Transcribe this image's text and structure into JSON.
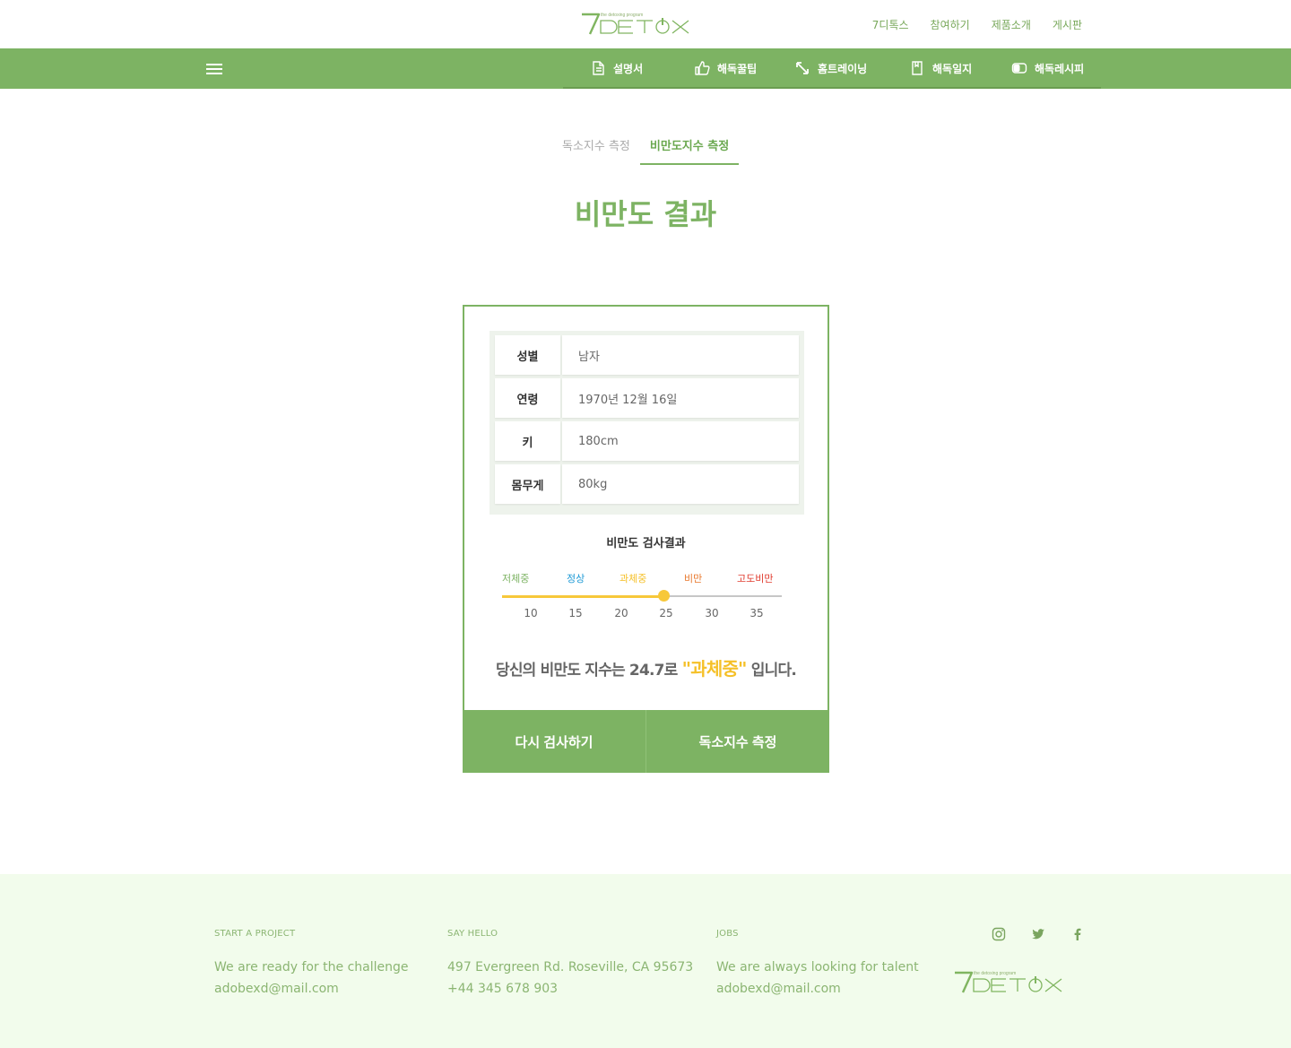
{
  "header": {
    "logo_text": "7DETOX",
    "logo_tagline": "the detoxing program",
    "links": [
      "7디톡스",
      "참여하기",
      "제품소개",
      "게시판"
    ]
  },
  "nav": {
    "items": [
      {
        "label": "설명서",
        "icon": "document-icon"
      },
      {
        "label": "해독꿀팁",
        "icon": "thumbs-up-icon"
      },
      {
        "label": "홈트레이닝",
        "icon": "expand-arrows-icon"
      },
      {
        "label": "해독일지",
        "icon": "notebook-icon"
      },
      {
        "label": "해독레시피",
        "icon": "toggle-icon"
      }
    ]
  },
  "tabs": [
    {
      "label": "독소지수 측정",
      "active": false
    },
    {
      "label": "비만도지수 측정",
      "active": true
    }
  ],
  "page_title": "비만도 결과",
  "info": {
    "rows": [
      {
        "label": "성별",
        "value": "남자"
      },
      {
        "label": "연령",
        "value": "1970년 12월 16일"
      },
      {
        "label": "키",
        "value": "180cm"
      },
      {
        "label": "몸무게",
        "value": "80kg"
      }
    ]
  },
  "result": {
    "heading": "비만도 검사결과",
    "categories": [
      {
        "label": "저체중",
        "color": "#7db363"
      },
      {
        "label": "정상",
        "color": "#1e9ad6"
      },
      {
        "label": "과체중",
        "color": "#f5c028"
      },
      {
        "label": "비만",
        "color": "#e8762a"
      },
      {
        "label": "고도비만",
        "color": "#e03a2d"
      }
    ],
    "ticks": [
      "10",
      "15",
      "20",
      "25",
      "30",
      "35"
    ],
    "bmi_value": 24.7,
    "summary_prefix": "당신의 비만도 지수는 24.7로",
    "summary_category": "\"과체중\"",
    "summary_suffix": "입니다."
  },
  "buttons": {
    "retry": "다시 검사하기",
    "toxin": "독소지수 측정"
  },
  "footer": {
    "project": {
      "heading": "START A PROJECT",
      "line1": "We are ready for the challenge",
      "line2": "adobexd@mail.com"
    },
    "hello": {
      "heading": "SAY HELLO",
      "line1": "497 Evergreen Rd. Roseville, CA 95673",
      "line2": "+44 345 678 903"
    },
    "jobs": {
      "heading": "JOBS",
      "line1": "We are always looking for talent",
      "line2": "adobexd@mail.com"
    },
    "social": [
      "instagram-icon",
      "twitter-icon",
      "facebook-icon"
    ],
    "logo_text": "7DETOX",
    "logo_tagline": "the detoxing program"
  }
}
